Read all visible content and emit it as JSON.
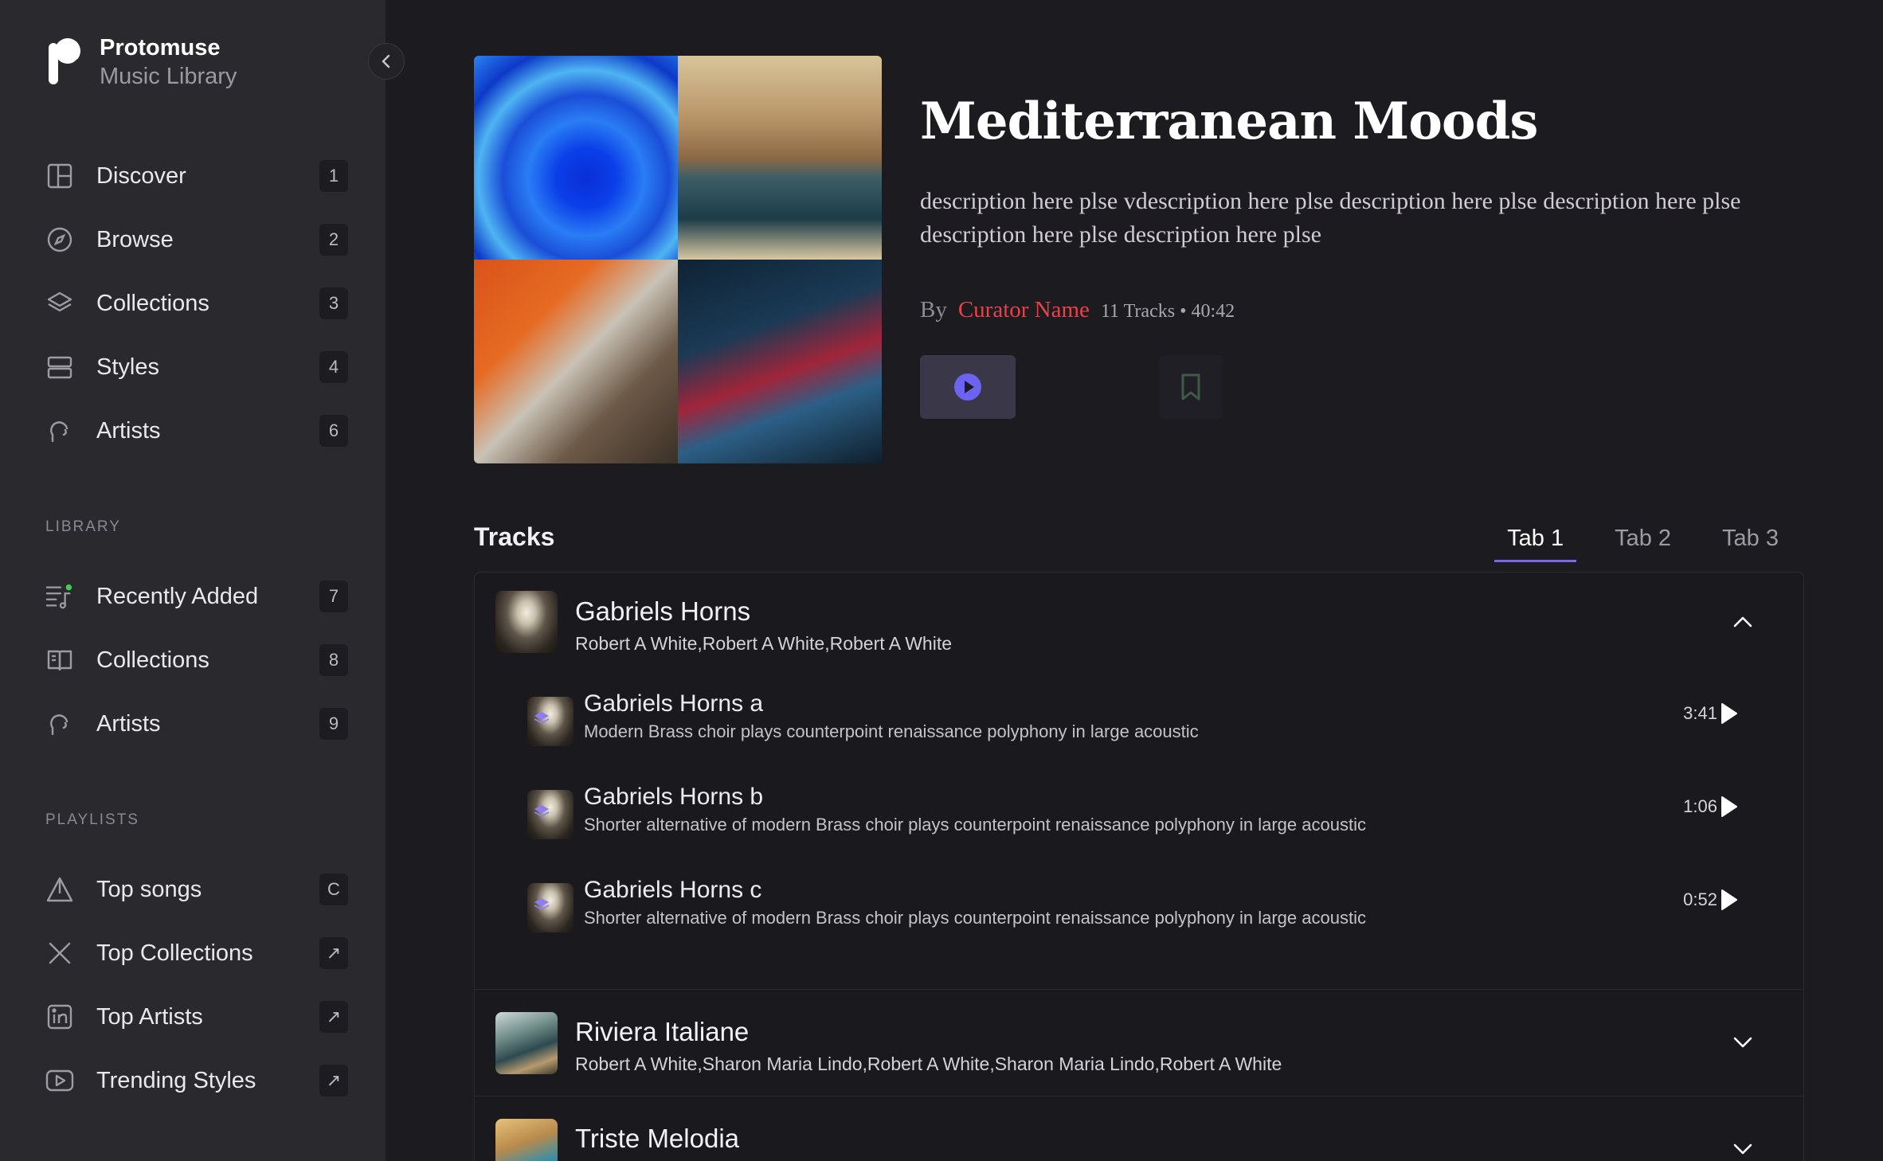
{
  "brand": {
    "name": "Protomuse",
    "subtitle": "Music Library"
  },
  "nav": {
    "main": [
      {
        "label": "Discover",
        "badge": "1",
        "icon": "grid-icon"
      },
      {
        "label": "Browse",
        "badge": "2",
        "icon": "compass-icon"
      },
      {
        "label": "Collections",
        "badge": "3",
        "icon": "layers-icon"
      },
      {
        "label": "Styles",
        "badge": "4",
        "icon": "stack-icon"
      },
      {
        "label": "Artists",
        "badge": "6",
        "icon": "headphones-icon"
      }
    ],
    "library_title": "LIBRARY",
    "library": [
      {
        "label": "Recently Added",
        "badge": "7",
        "icon": "playlist-music-icon"
      },
      {
        "label": "Collections",
        "badge": "8",
        "icon": "book-icon"
      },
      {
        "label": "Artists",
        "badge": "9",
        "icon": "headphones-icon"
      }
    ],
    "playlists_title": "PLAYLISTS",
    "playlists": [
      {
        "label": "Top songs",
        "badge": "C",
        "icon": "triangle-icon"
      },
      {
        "label": "Top Collections",
        "badge": "↗",
        "icon": "x-logo-icon"
      },
      {
        "label": "Top Artists",
        "badge": "↗",
        "icon": "linkedin-icon"
      },
      {
        "label": "Trending Styles",
        "badge": "↗",
        "icon": "youtube-icon"
      }
    ]
  },
  "playlist": {
    "title": "Mediterranean Moods",
    "description": "description here plse vdescription here plse description here plse description here plse description here plse description here plse",
    "by_label": "By",
    "curator": "Curator Name",
    "tracks_info": "11 Tracks • 40:42"
  },
  "tracks_section": {
    "heading": "Tracks",
    "tabs": [
      "Tab 1",
      "Tab 2",
      "Tab 3"
    ],
    "active_tab": 0
  },
  "groups": [
    {
      "title": "Gabriels Horns",
      "artists": "Robert A White,Robert A White,Robert A White",
      "expanded": true,
      "tracks": [
        {
          "title": "Gabriels Horns a",
          "description": "Modern Brass choir plays counterpoint renaissance polyphony in large acoustic",
          "duration": "3:41"
        },
        {
          "title": "Gabriels Horns b",
          "description": "Shorter alternative of modern Brass choir plays counterpoint renaissance polyphony in large acoustic",
          "duration": "1:06"
        },
        {
          "title": "Gabriels Horns c",
          "description": "Shorter alternative of modern Brass choir plays counterpoint renaissance polyphony in large acoustic",
          "duration": "0:52"
        }
      ]
    },
    {
      "title": "Riviera Italiane",
      "artists": "Robert A White,Sharon Maria Lindo,Robert A White,Sharon Maria Lindo,Robert A White",
      "expanded": false
    },
    {
      "title": "Triste Melodia",
      "artists": "",
      "expanded": false
    }
  ],
  "colors": {
    "background": "#1c1b1f",
    "sidebar": "#2a292e",
    "accent": "#7a67f0",
    "curator": "#e8414a",
    "status_dot": "#3ccf4e"
  }
}
